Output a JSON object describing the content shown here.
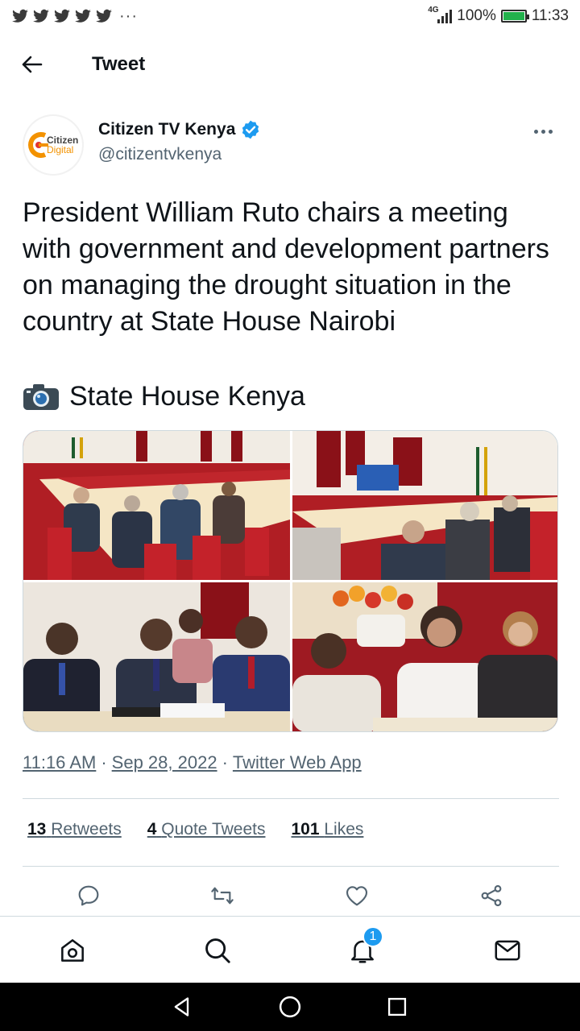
{
  "status_bar": {
    "network": "4G",
    "battery": "100%",
    "battery_level": 1.0,
    "time": "11:33",
    "notification_icons": [
      "twitter-icon",
      "twitter-icon",
      "twitter-icon",
      "twitter-icon",
      "twitter-icon"
    ],
    "more": "···"
  },
  "header": {
    "title": "Tweet",
    "back_icon": "arrow-left-icon"
  },
  "author": {
    "name": "Citizen TV Kenya",
    "handle": "@citizentvkenya",
    "verified": true,
    "avatar_line1": "Citizen",
    "avatar_line2": "Digital"
  },
  "tweet": {
    "text": "President William Ruto chairs a meeting with government and development partners on managing the drought situation in the country at State House Nairobi",
    "credit_icon": "camera-icon",
    "credit": "State House Kenya",
    "media_count": 4
  },
  "meta": {
    "time": "11:16 AM",
    "sep1": "·",
    "date": "Sep 28, 2022",
    "sep2": "·",
    "source": "Twitter Web App"
  },
  "stats": {
    "retweets_count": "13",
    "retweets_label": "Retweets",
    "quotes_count": "4",
    "quotes_label": "Quote Tweets",
    "likes_count": "101",
    "likes_label": "Likes"
  },
  "actions": [
    "reply-icon",
    "retweet-icon",
    "like-icon",
    "share-icon"
  ],
  "bottom_nav": {
    "items": [
      "home-icon",
      "search-icon",
      "notifications-icon",
      "messages-icon"
    ],
    "notification_badge": "1"
  },
  "colors": {
    "accent": "#1d9bf0",
    "text": "#0f1419",
    "secondary": "#536471",
    "border": "#cfd9de",
    "verified": "#1d9bf0"
  }
}
